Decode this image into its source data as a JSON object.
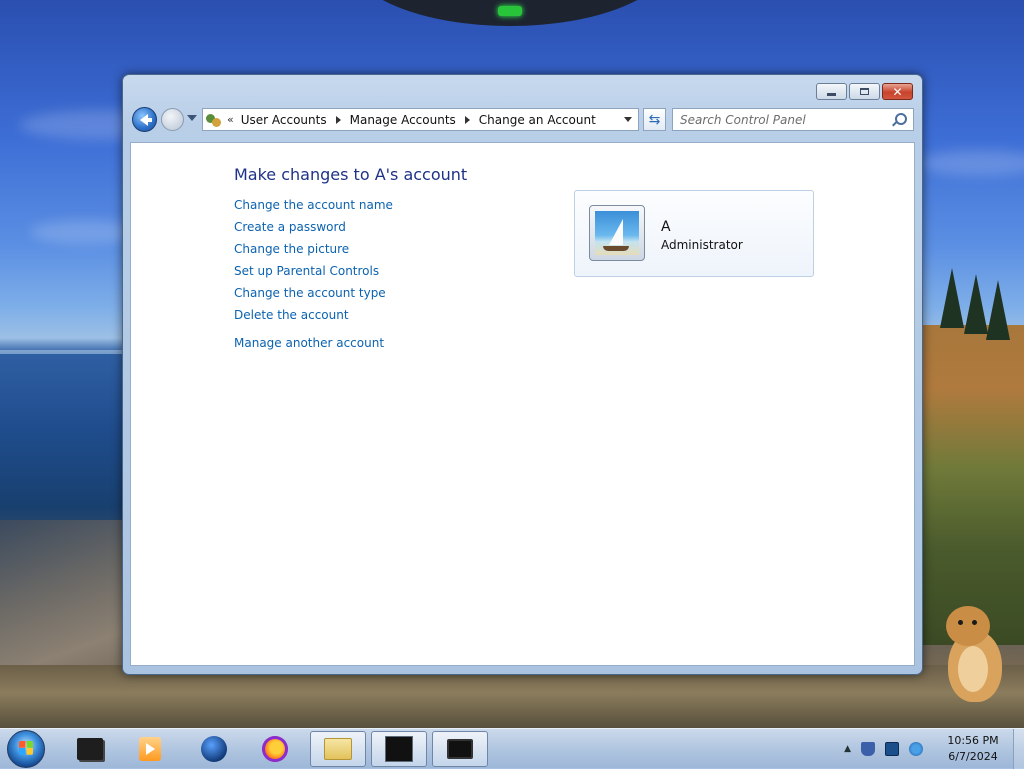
{
  "window": {
    "breadcrumbs": [
      "User Accounts",
      "Manage Accounts",
      "Change an Account"
    ],
    "search_placeholder": "Search Control Panel",
    "icons": {
      "back": "back-arrow-icon",
      "forward": "forward-arrow-icon",
      "refresh": "refresh-icon",
      "search": "search-icon",
      "minimize": "minimize-icon",
      "maximize": "maximize-icon",
      "close": "close-icon"
    }
  },
  "content": {
    "heading": "Make changes to A's account",
    "tasks": [
      "Change the account name",
      "Create a password",
      "Change the picture",
      "Set up Parental Controls",
      "Change the account type",
      "Delete the account"
    ],
    "manage_link": "Manage another account",
    "user": {
      "name": "A",
      "role": "Administrator",
      "picture": "sailboat-picture"
    }
  },
  "taskbar": {
    "items": [
      "start-orb",
      "app-dark-window",
      "media-player",
      "globe-app",
      "firefox",
      "file-explorer",
      "terminal",
      "terminal-2"
    ],
    "clock_time": "10:56 PM",
    "clock_date": "6/7/2024"
  },
  "colors": {
    "link": "#0b62b0",
    "heading": "#1e3287"
  }
}
